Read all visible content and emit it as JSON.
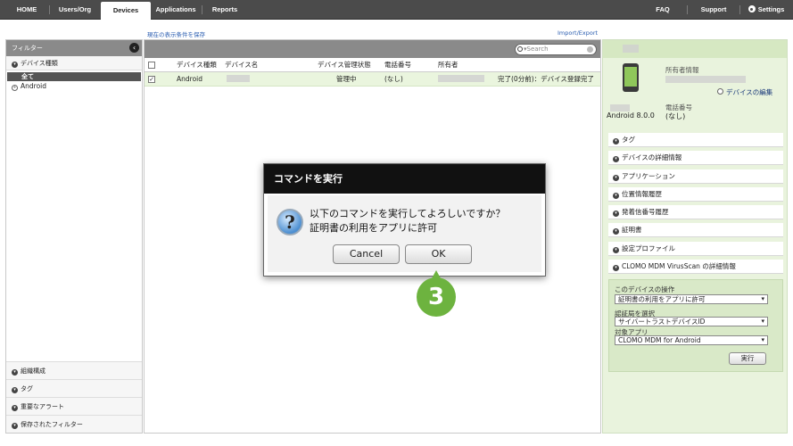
{
  "nav": {
    "home": "HOME",
    "users": "Users/Org",
    "devices": "Devices",
    "applications": "Applications",
    "reports": "Reports",
    "faq": "FAQ",
    "support": "Support",
    "settings": "Settings"
  },
  "links": {
    "save_filter": "現在の表示条件を保存",
    "import_export": "Import/Export"
  },
  "sidebar": {
    "title": "フィルター",
    "device_type": "デバイス種類",
    "selected": "全て",
    "android": "Android",
    "bottom": [
      "組織構成",
      "タグ",
      "重要なアラート",
      "保存されたフィルター"
    ]
  },
  "table": {
    "search_placeholder": "Search",
    "headers": [
      "デバイス種類",
      "デバイス名",
      "デバイス管理状態",
      "電話番号",
      "所有者"
    ],
    "row": {
      "type": "Android",
      "status": "管理中",
      "phone": "(なし)",
      "log": "完了(0分前)：デバイス登録完了"
    }
  },
  "right_panel": {
    "owner_label": "所有者情報",
    "edit_link": "デバイスの編集",
    "phone_label": "電話番号",
    "phone_value": "(なし)",
    "os": "Android 8.0.0",
    "accordions": [
      "タグ",
      "デバイスの詳細情報",
      "アプリケーション",
      "位置情報履歴",
      "発着信番号履歴",
      "証明書",
      "設定プロファイル",
      "CLOMO MDM VirusScan の詳細情報"
    ],
    "ops_title": "このデバイスの操作",
    "ops_command": "証明書の利用をアプリに許可",
    "cert_label": "認証局を選択",
    "cert_value": "サイバートラストデバイスID",
    "app_label": "対象アプリ",
    "app_value": "CLOMO MDM for Android",
    "run": "実行"
  },
  "dialog": {
    "title": "コマンドを実行",
    "line1": "以下のコマンドを実行してよろしいですか？",
    "line2": "証明書の利用をアプリに許可",
    "cancel": "Cancel",
    "ok": "OK"
  },
  "step_badge": "3",
  "colors": {
    "nav_bg": "#4b4b4b",
    "panel_green": "#e9f3dd",
    "badge_green": "#6db33f",
    "link_blue": "#2a5db0"
  }
}
